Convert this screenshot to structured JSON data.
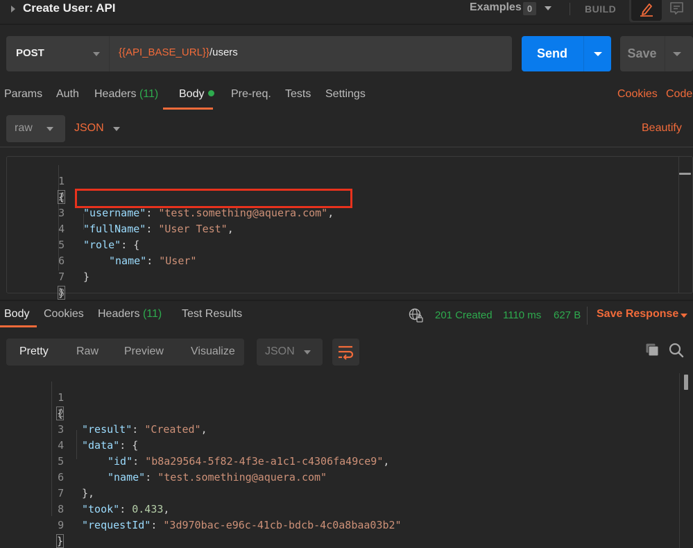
{
  "header": {
    "title": "Create User: API",
    "examples_label": "Examples",
    "examples_count": "0",
    "build_label": "BUILD",
    "icons": {
      "expand": "caret-right-icon",
      "edit": "pencil-icon",
      "comments": "comment-icon"
    }
  },
  "request": {
    "method": "POST",
    "url_variable": "{{API_BASE_URL}}",
    "url_path": "/users",
    "send_label": "Send",
    "save_label": "Save"
  },
  "request_tabs": {
    "items": [
      {
        "label": "Params"
      },
      {
        "label": "Auth"
      },
      {
        "label": "Headers",
        "count": "(11)"
      },
      {
        "label": "Body",
        "active": true,
        "has_content_dot": true
      },
      {
        "label": "Pre-req."
      },
      {
        "label": "Tests"
      },
      {
        "label": "Settings"
      }
    ],
    "cookies_label": "Cookies",
    "code_label": "Code"
  },
  "body_options": {
    "body_type": "raw",
    "language": "JSON",
    "beautify_label": "Beautify"
  },
  "request_body": {
    "line_numbers": [
      "1",
      "2",
      "3",
      "4",
      "5",
      "6",
      "7",
      "8"
    ],
    "lines": [
      {
        "open": "{"
      },
      {
        "key": "\"username\"",
        "sep": ": ",
        "str": "\"test.something@aquera.com\"",
        "tail": ","
      },
      {
        "key": "\"fullName\"",
        "sep": ": ",
        "str": "\"User Test\"",
        "tail": ","
      },
      {
        "key": "\"role\"",
        "sep": ": ",
        "tail": "{"
      },
      {
        "key": "\"name\"",
        "sep": ": ",
        "str": "\"User\""
      },
      {
        "punct": "}"
      },
      {
        "close": "}"
      },
      {}
    ],
    "highlighted_line": 3
  },
  "response_tabs": {
    "items": [
      {
        "label": "Body",
        "active": true
      },
      {
        "label": "Cookies"
      },
      {
        "label": "Headers",
        "count": "(11)"
      },
      {
        "label": "Test Results"
      }
    ]
  },
  "response_meta": {
    "status": "201 Created",
    "time": "1110 ms",
    "size": "627 B",
    "save_response_label": "Save Response",
    "status_color": "#2eab4e"
  },
  "response_view": {
    "modes": [
      "Pretty",
      "Raw",
      "Preview",
      "Visualize"
    ],
    "active_mode": "Pretty",
    "language": "JSON",
    "icons": {
      "wrap": "wrap-lines-icon",
      "copy": "copy-icon",
      "search": "search-icon",
      "network": "globe-lock-icon"
    }
  },
  "response_body": {
    "line_numbers": [
      "1",
      "2",
      "3",
      "4",
      "5",
      "6",
      "7",
      "8",
      "9"
    ],
    "lines": [
      {
        "open": "{"
      },
      {
        "key": "\"result\"",
        "sep": ": ",
        "str": "\"Created\"",
        "tail": ","
      },
      {
        "key": "\"data\"",
        "sep": ": ",
        "tail": "{"
      },
      {
        "key": "\"id\"",
        "sep": ": ",
        "str": "\"b8a29564-5f82-4f3e-a1c1-c4306fa49ce9\"",
        "tail": ","
      },
      {
        "key": "\"name\"",
        "sep": ": ",
        "str": "\"test.something@aquera.com\""
      },
      {
        "punct": "},"
      },
      {
        "key": "\"took\"",
        "sep": ": ",
        "num": "0.433",
        "tail": ","
      },
      {
        "key": "\"requestId\"",
        "sep": ": ",
        "str": "\"3d970bac-e96c-41cb-bdcb-4c0a8baa03b2\""
      },
      {
        "close": "}"
      }
    ]
  },
  "colors": {
    "accent": "#f26b3a",
    "primary_button": "#097bed",
    "success": "#2eab4e",
    "highlight_box": "#e8321d"
  }
}
